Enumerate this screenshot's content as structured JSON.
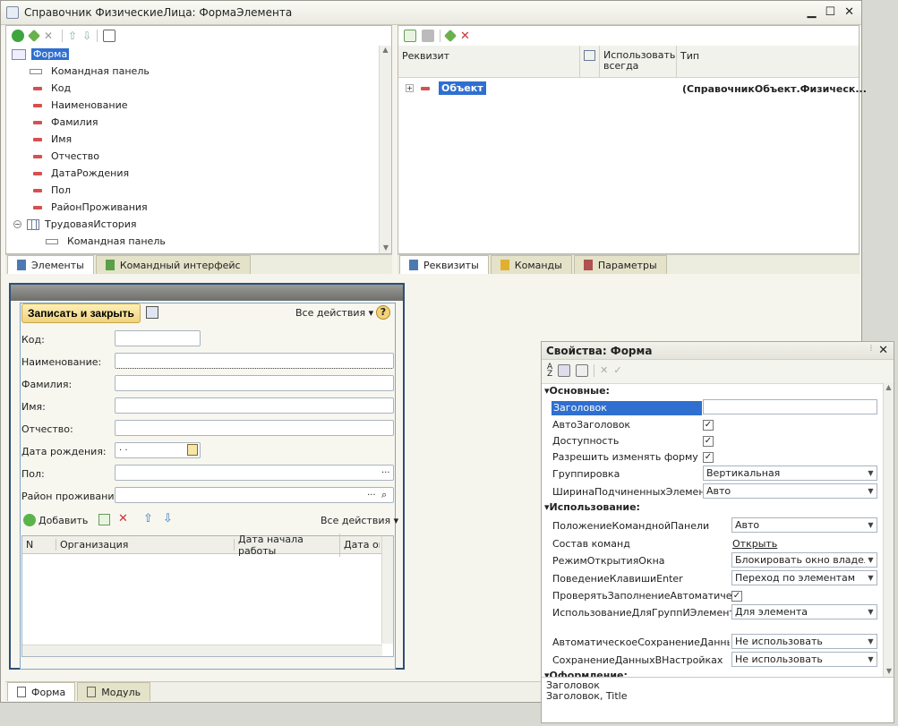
{
  "window": {
    "title": "Справочник ФизическиеЛица: ФормаЭлемента"
  },
  "elements_tree": {
    "root": "Форма",
    "items": [
      "Командная панель",
      "Код",
      "Наименование",
      "Фамилия",
      "Имя",
      "Отчество",
      "ДатаРождения",
      "Пол",
      "РайонПроживания"
    ],
    "table": "ТрудоваяИстория",
    "table_child": "Командная панель"
  },
  "left_tabs": [
    "Элементы",
    "Командный интерфейс"
  ],
  "requisites": {
    "columns": [
      "Реквизит",
      "Использовать всегда",
      "Тип"
    ],
    "row": {
      "name": "Объект",
      "type": "(СправочникОбъект.Физическ..."
    }
  },
  "right_tabs": [
    "Реквизиты",
    "Команды",
    "Параметры"
  ],
  "form": {
    "save_close": "Записать и закрыть",
    "all_actions": "Все действия",
    "help": "?",
    "fields": [
      "Код:",
      "Наименование:",
      "Фамилия:",
      "Имя:",
      "Отчество:",
      "Дата рождения:",
      "Пол:",
      "Район проживания:"
    ],
    "date_value": " .  .",
    "ellipsis": "...",
    "add": "Добавить",
    "table_all_actions": "Все действия",
    "table_columns": [
      "N",
      "Организация",
      "Дата начала работы",
      "Дата ок"
    ]
  },
  "bottom_tabs": [
    "Форма",
    "Модуль"
  ],
  "properties": {
    "title": "Свойства: Форма",
    "sections": [
      "Основные:",
      "Использование:",
      "Оформление:"
    ],
    "basic": [
      {
        "name": "Заголовок",
        "value": ""
      },
      {
        "name": "АвтоЗаголовок",
        "value": "✓"
      },
      {
        "name": "Доступность",
        "value": "✓"
      },
      {
        "name": "Разрешить изменять форму",
        "value": "✓"
      },
      {
        "name": "Группировка",
        "value": "Вертикальная"
      },
      {
        "name": "ШиринаПодчиненныхЭлементов",
        "value": "Авто"
      }
    ],
    "usage": [
      {
        "name": "ПоложениеКоманднойПанели",
        "value": "Авто"
      },
      {
        "name": "Состав команд",
        "value": "Открыть"
      },
      {
        "name": "РежимОткрытияОкна",
        "value": "Блокировать окно владельц"
      },
      {
        "name": "ПоведениеКлавишиEnter",
        "value": "Переход по элементам"
      },
      {
        "name": "ПроверятьЗаполнениеАвтоматически",
        "value": "✓"
      },
      {
        "name": "ИспользованиеДляГруппИЭлементов",
        "value": "Для элемента"
      },
      {
        "name": "АвтоматическоеСохранениеДанныхВН",
        "value": "Не использовать"
      },
      {
        "name": "СохранениеДанныхВНастройках",
        "value": "Не использовать"
      }
    ],
    "desc_title": "Заголовок",
    "desc_text": "Заголовок, Title"
  },
  "colors": {
    "accent": "#2d4f78",
    "selection": "#2f6fd0",
    "button": "#efd27d"
  }
}
